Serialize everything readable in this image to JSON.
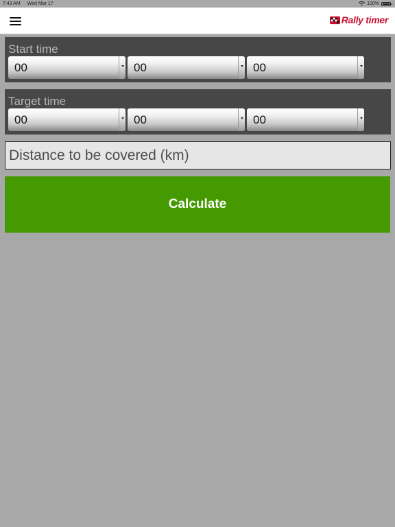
{
  "status_bar": {
    "time": "7:43 AM",
    "date": "Wed Mar 17",
    "battery": "100%"
  },
  "header": {
    "menu_icon": "hamburger-menu-icon",
    "logo": {
      "icon": "checkered-flag-icon",
      "word1": "Rally",
      "word2": "timer"
    }
  },
  "start_time": {
    "label": "Start time",
    "selects": [
      {
        "value": "00"
      },
      {
        "value": "00"
      },
      {
        "value": "00"
      }
    ]
  },
  "target_time": {
    "label": "Target time",
    "selects": [
      {
        "value": "00"
      },
      {
        "value": "00"
      },
      {
        "value": "00"
      }
    ]
  },
  "distance": {
    "placeholder": "Distance to be covered (km)",
    "value": ""
  },
  "calculate_button": {
    "label": "Calculate"
  },
  "colors": {
    "background": "#a8a8a8",
    "panel": "#474747",
    "button": "#449a00",
    "brand": "#c8102e"
  }
}
